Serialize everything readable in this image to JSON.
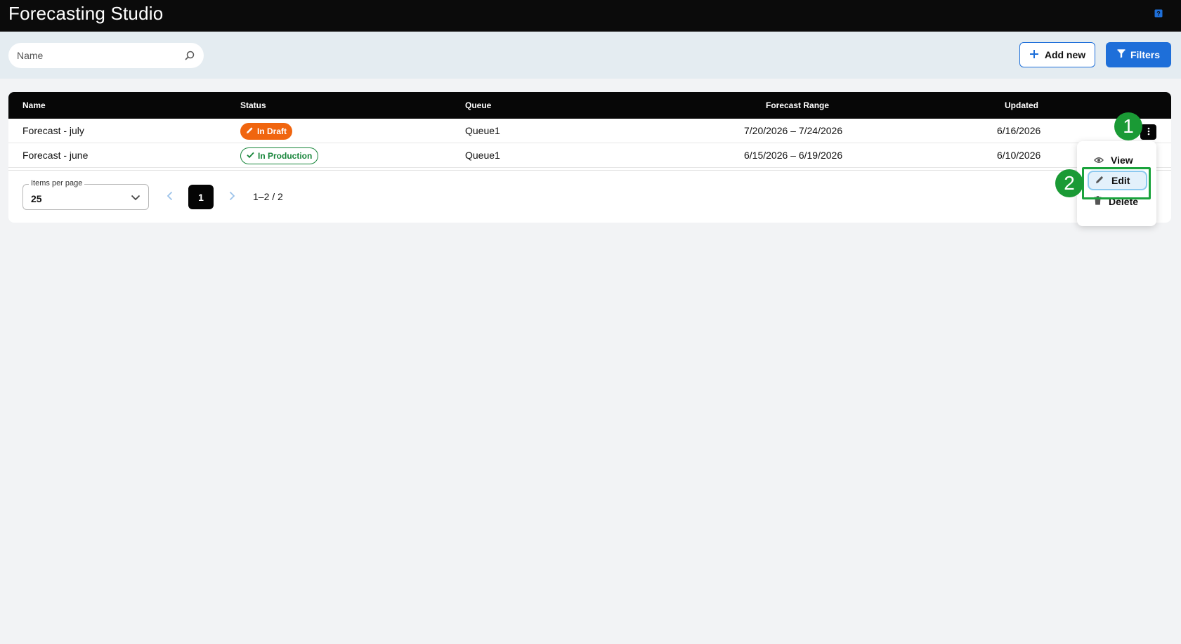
{
  "app": {
    "title": "Forecasting Studio"
  },
  "toolbar": {
    "search_placeholder": "Name",
    "add_new_label": "Add new",
    "filters_label": "Filters"
  },
  "table": {
    "columns": [
      "Name",
      "Status",
      "Queue",
      "Forecast Range",
      "Updated"
    ],
    "rows": [
      {
        "name": "Forecast - july",
        "status": "In Draft",
        "queue": "Queue1",
        "range": "7/20/2026 – 7/24/2026",
        "updated": "6/16/2026"
      },
      {
        "name": "Forecast - june",
        "status": "In Production",
        "queue": "Queue1",
        "range": "6/15/2026 – 6/19/2026",
        "updated": "6/10/2026"
      }
    ]
  },
  "pagination": {
    "items_per_page_label": "Items per page",
    "items_per_page_value": "25",
    "current_page": "1",
    "range_text": "1–2 / 2"
  },
  "row_menu": {
    "items": [
      "View",
      "Edit",
      "Delete"
    ]
  },
  "annotations": {
    "marker1": "1",
    "marker2": "2"
  },
  "colors": {
    "header_bg": "#0b0b0b",
    "accent_blue": "#1e6fd9",
    "draft_orange": "#f0650f",
    "production_green": "#17853a",
    "marker_green": "#1a9a35"
  },
  "icons": [
    "help-icon",
    "search-icon",
    "plus-icon",
    "filter-icon",
    "pencil-icon",
    "check-icon",
    "kebab-icon",
    "chevron-down-icon",
    "chevron-left-icon",
    "chevron-right-icon",
    "eye-icon",
    "trash-icon"
  ]
}
